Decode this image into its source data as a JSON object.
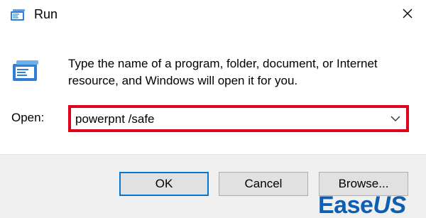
{
  "window": {
    "title": "Run",
    "close_glyph": "✕"
  },
  "body": {
    "description": "Type the name of a program, folder, document, or Internet resource, and Windows will open it for you.",
    "open_label": "Open:",
    "command_value": "powerpnt /safe"
  },
  "buttons": {
    "ok": "OK",
    "cancel": "Cancel",
    "browse": "Browse..."
  },
  "watermark": {
    "brand_a": "Ease",
    "brand_b": "US"
  },
  "colors": {
    "highlight_border": "#e0001b",
    "focus_blue": "#0078d7",
    "footer_bg": "#f0f0f0",
    "watermark": "#0d5fb3"
  },
  "icons": {
    "title": "run-app-icon",
    "large": "run-app-icon",
    "close": "close-icon",
    "dropdown": "chevron-down-icon"
  }
}
